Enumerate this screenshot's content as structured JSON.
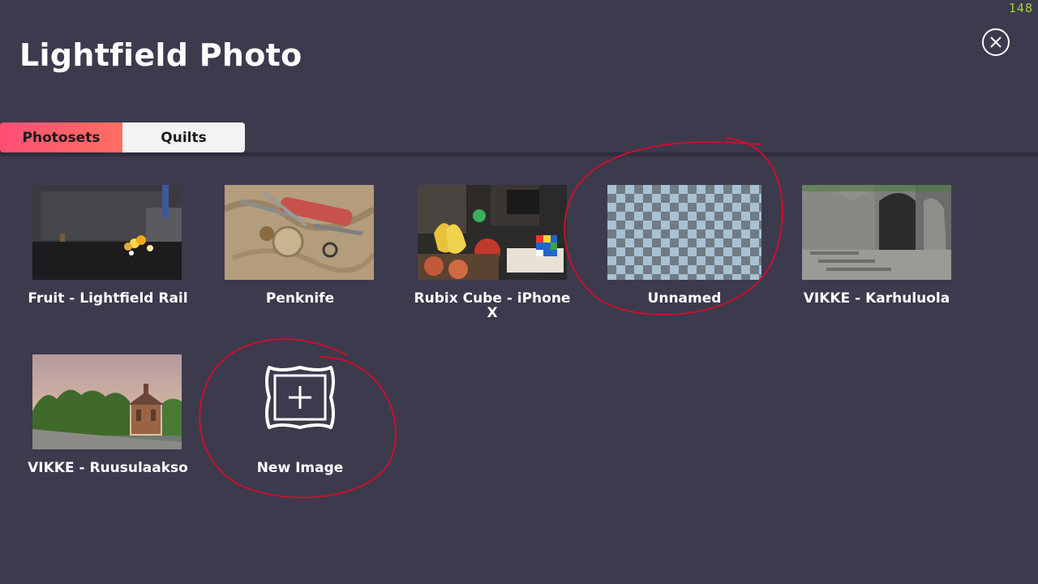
{
  "app": {
    "title": "Lightfield Photo",
    "fps_counter": "148",
    "close_icon": "close-circle-icon"
  },
  "tabs": [
    {
      "label": "Photosets",
      "active": true
    },
    {
      "label": "Quilts",
      "active": false
    }
  ],
  "gallery": {
    "items": [
      {
        "label": "Fruit - Lightfield Rail",
        "thumb": "fruit-photo"
      },
      {
        "label": "Penknife",
        "thumb": "penknife-photo"
      },
      {
        "label": "Rubix Cube - iPhone X",
        "thumb": "rubix-cube-photo"
      },
      {
        "label": "Unnamed",
        "thumb": "checkerboard-placeholder"
      },
      {
        "label": "VIKKE - Karhuluola",
        "thumb": "cave-photo"
      },
      {
        "label": "VIKKE - Ruusulaakso",
        "thumb": "garden-pavilion-photo"
      }
    ],
    "new_image": {
      "label": "New Image",
      "icon": "frame-plus-icon"
    }
  },
  "colors": {
    "background": "#3c3a4d",
    "tab_active_start": "#ff4f75",
    "tab_active_end": "#ff6f62",
    "tab_inactive": "#f3f3f3",
    "annotation": "#c8102e",
    "fps": "#9fd23a"
  }
}
